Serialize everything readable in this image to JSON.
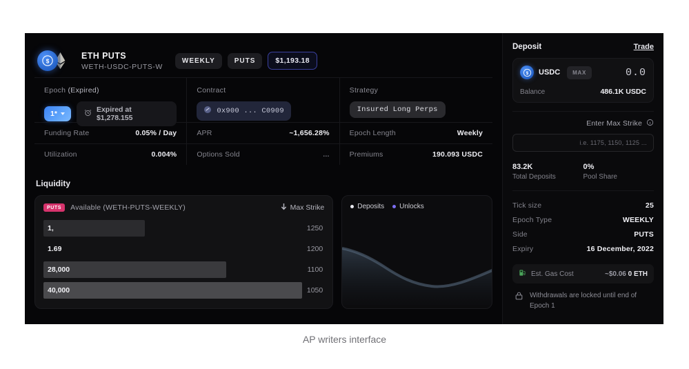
{
  "caption": "AP writers interface",
  "header": {
    "title": "ETH PUTS",
    "subtitle": "WETH-USDC-PUTS-W",
    "badge_weekly": "WEEKLY",
    "badge_puts": "PUTS",
    "badge_price": "$1,193.18",
    "usdc_icon": "usdc-coin-icon",
    "eth_icon": "ethereum-icon"
  },
  "stats": {
    "epoch": {
      "label": "Epoch",
      "status": "(Expired)",
      "pill": "1*",
      "expired_text": "Expired at $1,278.155",
      "clock_icon": "alarm-clock-icon"
    },
    "contract": {
      "label": "Contract",
      "address": "0x900 ... C0909",
      "icon": "contract-link-icon"
    },
    "strategy": {
      "label": "Strategy",
      "value": "Insured Long Perps"
    },
    "rows": [
      {
        "k": "Funding Rate",
        "v": "0.05% / Day"
      },
      {
        "k": "APR",
        "v": "~1,656.28%"
      },
      {
        "k": "Epoch Length",
        "v": "Weekly"
      },
      {
        "k": "Utilization",
        "v": "0.004%"
      },
      {
        "k": "Options Sold",
        "v": "..."
      },
      {
        "k": "Premiums",
        "v": "190.093 USDC"
      }
    ]
  },
  "liquidity": {
    "title": "Liquidity",
    "badge": "PUTS",
    "available_label": "Available (WETH-PUTS-WEEKLY)",
    "max_strike_label": "Max Strike",
    "sort_icon": "arrow-down-icon",
    "rows": [
      {
        "amount": "1,",
        "strike": "1250",
        "bar_pct": 36,
        "bar_color": "#2b2b2e"
      },
      {
        "amount": "1.69",
        "strike": "1200",
        "bar_pct": 0,
        "bar_color": "#2b2b2e"
      },
      {
        "amount": "28,000",
        "strike": "1100",
        "bar_pct": 65,
        "bar_color": "#3a3a3d"
      },
      {
        "amount": "40,000",
        "strike": "1050",
        "bar_pct": 92,
        "bar_color": "#4a4a4d"
      }
    ]
  },
  "chart_data": {
    "type": "area",
    "title": "",
    "legend": [
      {
        "name": "Deposits",
        "color": "#e8e8ee"
      },
      {
        "name": "Unlocks",
        "color": "#7c6ef2"
      }
    ],
    "legend_position": "top-left",
    "grid": false,
    "x": [
      0,
      1,
      2,
      3,
      4,
      5,
      6,
      7,
      8
    ],
    "series": [
      {
        "name": "Deposits",
        "values": [
          62,
          58,
          48,
          36,
          28,
          26,
          27,
          33,
          44
        ],
        "color": "#3a4a5a"
      },
      {
        "name": "Unlocks",
        "values": [
          0,
          0,
          0,
          0,
          0,
          0,
          0,
          0,
          0
        ],
        "color": "#7c6ef2"
      }
    ],
    "ylim": [
      0,
      100
    ],
    "xlabel": "",
    "ylabel": ""
  },
  "deposit": {
    "title": "Deposit",
    "trade_link": "Trade",
    "token": "USDC",
    "token_icon": "usdc-coin-icon",
    "max_button": "MAX",
    "amount": "0.0",
    "balance_label": "Balance",
    "balance_value": "486.1K USDC",
    "strike_label": "Enter Max Strike",
    "strike_help_icon": "info-circle-icon",
    "strike_placeholder": "i.e. 1175, 1150, 1125 ...",
    "totals": [
      {
        "value": "83.2K",
        "label": "Total Deposits"
      },
      {
        "value": "0%",
        "label": "Pool Share"
      }
    ],
    "info_rows": [
      {
        "k": "Tick size",
        "v": "25"
      },
      {
        "k": "Epoch Type",
        "v": "WEEKLY"
      },
      {
        "k": "Side",
        "v": "PUTS"
      },
      {
        "k": "Expiry",
        "v": "16 December, 2022"
      }
    ],
    "gas": {
      "icon": "gas-pump-icon",
      "label": "Est. Gas Cost",
      "usd": "~$0.06",
      "eth": "0 ETH"
    },
    "lock": {
      "icon": "lock-icon",
      "text": "Withdrawals are locked until end of Epoch 1"
    }
  },
  "colors": {
    "accent_blue": "#3b82f6",
    "puts_pink": "#d6336c",
    "unlocks_purple": "#7c6ef2",
    "gas_green": "#4ba35a"
  }
}
